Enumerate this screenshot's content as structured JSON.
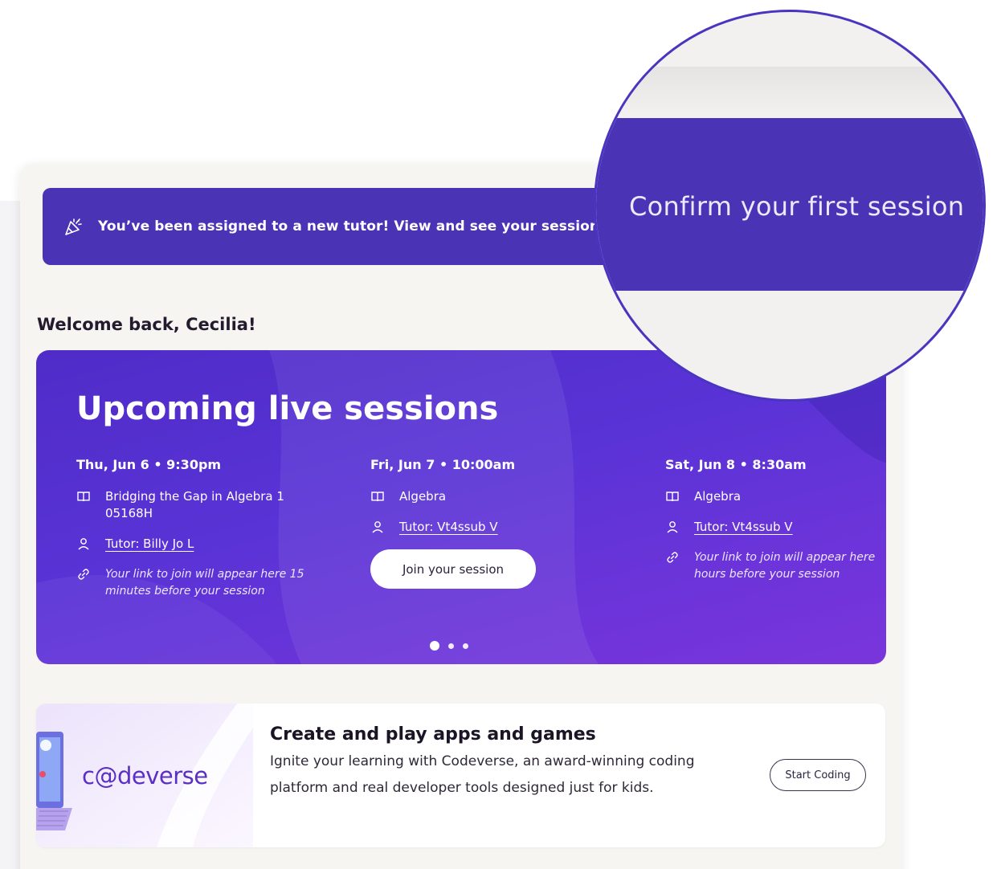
{
  "banner": {
    "text": "You’ve been assigned to a new tutor! View and see your session",
    "icon": "party-popper-icon"
  },
  "welcome": "Welcome back, Cecilia!",
  "sessions": {
    "title": "Upcoming live sessions",
    "items": [
      {
        "date": "Thu, Jun 6 • 9:30pm",
        "course": "Bridging the Gap in Algebra 1 05168H",
        "tutor": "Tutor: Billy Jo L",
        "note": "Your link to join will appear here 15 minutes before your session"
      },
      {
        "date": "Fri, Jun 7 • 10:00am",
        "course": "Algebra",
        "tutor": "Tutor: Vt4ssub V",
        "button": "Join your session"
      },
      {
        "date": "Sat, Jun 8 • 8:30am",
        "course": "Algebra",
        "tutor": "Tutor: Vt4ssub V",
        "note": "Your link to join will appear here hours before your session"
      }
    ],
    "carousel_active_index": 0
  },
  "codeverse": {
    "logo": "c@deverse",
    "title": "Create and play apps and games",
    "description": "Ignite your learning with Codeverse, an award-winning coding platform and real developer tools designed just for kids.",
    "button": "Start Coding"
  },
  "magnifier": {
    "text": "Confirm your first session"
  },
  "colors": {
    "banner": "#4a33b4",
    "sessions_gradient_start": "#4f2cc8",
    "sessions_gradient_end": "#7a35dc",
    "codeverse_brand": "#5a2fc2"
  }
}
